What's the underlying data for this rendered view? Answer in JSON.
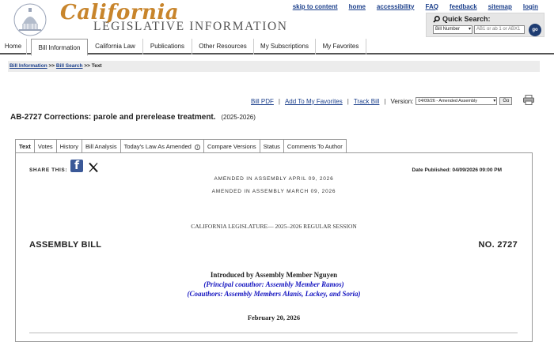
{
  "brand": {
    "script": "California",
    "subtitle": "LEGISLATIVE INFORMATION"
  },
  "top_links": [
    "skip to content",
    "home",
    "accessibility",
    "FAQ",
    "feedback",
    "sitemap",
    "login"
  ],
  "quick_search": {
    "title": "Quick Search:",
    "type_value": "Bill Number",
    "input_placeholder": "AB1 or ab 1 or ABX1",
    "go_label": "go"
  },
  "nav": {
    "items": [
      "Home",
      "Bill Information",
      "California Law",
      "Publications",
      "Other Resources",
      "My Subscriptions",
      "My Favorites"
    ],
    "active_index": 1
  },
  "breadcrumb": {
    "items": [
      "Bill Information",
      "Bill Search"
    ],
    "separator": ">>",
    "current": "Text"
  },
  "actions": {
    "bill_pdf": "Bill PDF",
    "add_favorites": "Add To My Favorites",
    "track_bill": "Track Bill",
    "version_label": "Version:",
    "version_value": "04/09/26 - Amended Assembly",
    "go_label": "Go"
  },
  "bill": {
    "title": "AB-2727 Corrections: parole and prerelease treatment.",
    "session": "(2025-2026)"
  },
  "tabs": {
    "items": [
      "Text",
      "Votes",
      "History",
      "Bill Analysis",
      "Today's Law As Amended",
      "Compare Versions",
      "Status",
      "Comments To Author"
    ],
    "active_index": 0
  },
  "content": {
    "share_label": "SHARE THIS:",
    "date_published": "Date Published: 04/09/2026 09:00 PM",
    "amended_1": "AMENDED  IN  ASSEMBLY  APRIL 09, 2026",
    "amended_2": "AMENDED  IN  ASSEMBLY  MARCH 09, 2026",
    "legislature": "CALIFORNIA LEGISLATURE— 2025–2026 REGULAR SESSION",
    "house": "ASSEMBLY BILL",
    "number": "NO. 2727",
    "introduced": "Introduced by Assembly Member Nguyen",
    "principal_coauthor": "(Principal coauthor: Assembly Member Ramos)",
    "coauthors": "(Coauthors: Assembly Members Alanis, Lackey, and Soria)",
    "intro_date": "February 20, 2026"
  },
  "colors": {
    "link": "#1b3f8b",
    "brand_gold": "#c8852c",
    "coauthor_blue": "#1515c0",
    "facebook": "#3b5998",
    "go_button": "#1e3c72"
  }
}
